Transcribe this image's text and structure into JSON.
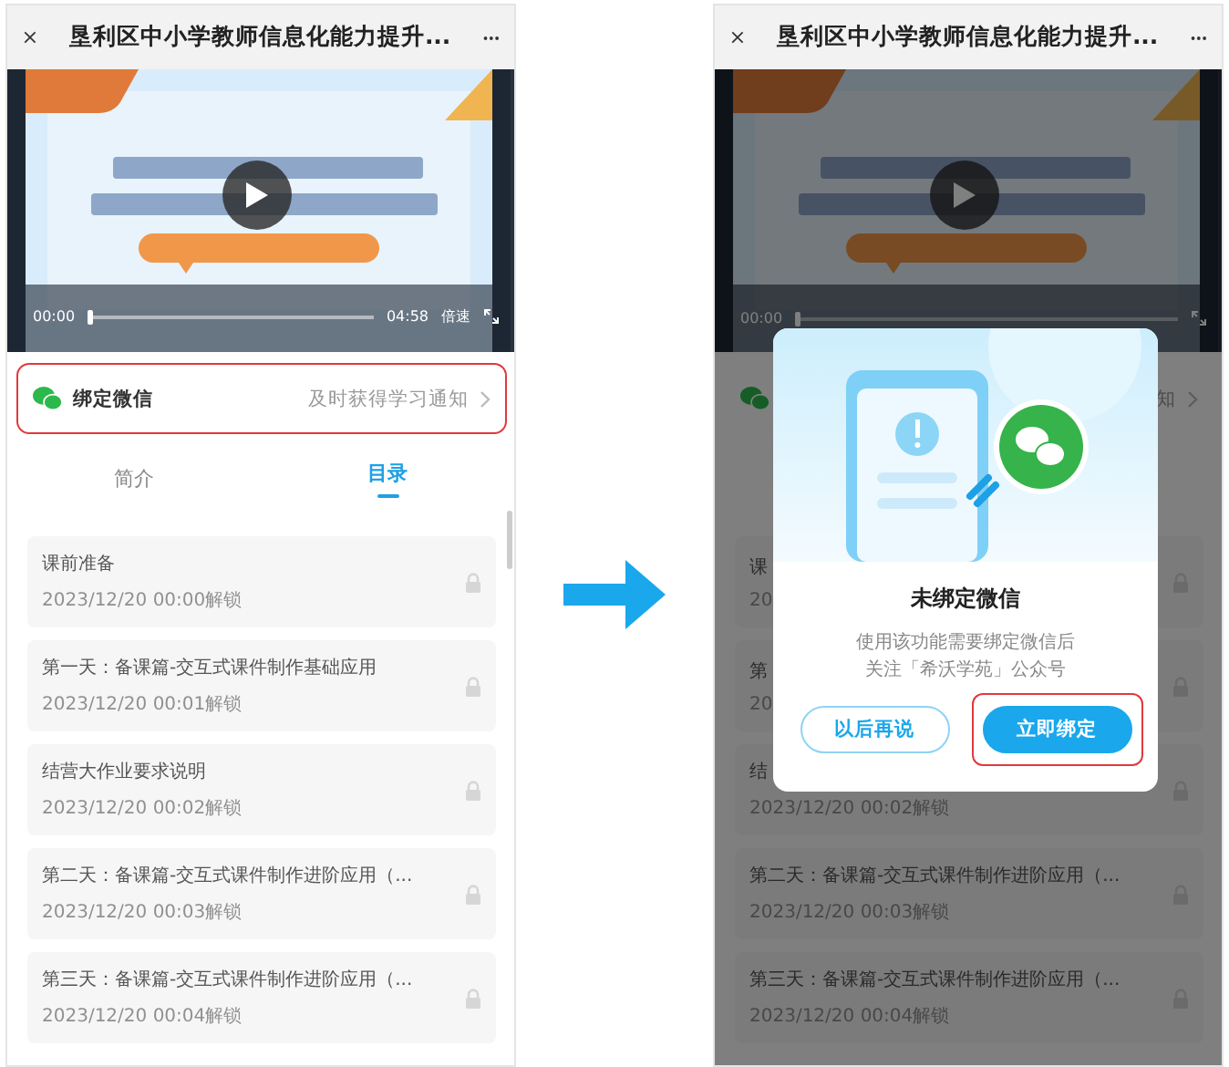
{
  "screens": [
    {
      "nav": {
        "title": "垦利区中小学教师信息化能力提升..."
      },
      "player": {
        "elapsed": "00:00",
        "duration": "04:58",
        "speed": "倍速",
        "level": 0
      },
      "bind_row": {
        "label": "绑定微信",
        "hint": "及时获得学习通知",
        "highlighted": true
      },
      "tabs": [
        {
          "label": "简介",
          "selected": false
        },
        {
          "label": "目录",
          "selected": true
        }
      ],
      "lessons": [
        {
          "title": "课前准备",
          "unlock": "2023/12/20 00:00解锁",
          "locked": true
        },
        {
          "title": "第一天：备课篇-交互式课件制作基础应用",
          "unlock": "2023/12/20 00:01解锁",
          "locked": true
        },
        {
          "title": "结营大作业要求说明",
          "unlock": "2023/12/20 00:02解锁",
          "locked": true
        },
        {
          "title": "第二天：备课篇-交互式课件制作进阶应用（...",
          "unlock": "2023/12/20 00:03解锁",
          "locked": true
        },
        {
          "title": "第三天：备课篇-交互式课件制作进阶应用（...",
          "unlock": "2023/12/20 00:04解锁",
          "locked": true
        }
      ],
      "dimmed": false
    },
    {
      "nav": {
        "title": "垦利区中小学教师信息化能力提升..."
      },
      "player": {
        "elapsed": "00:00",
        "level": 0
      },
      "bind_row": {
        "hint": "知",
        "highlighted": false
      },
      "lessons": [
        {
          "title": "课",
          "unlock": "20",
          "locked": true
        },
        {
          "title": "第",
          "unlock": "20",
          "locked": true
        },
        {
          "title": "结",
          "unlock": "2023/12/20 00:02解锁",
          "locked": true
        },
        {
          "title": "第二天：备课篇-交互式课件制作进阶应用（...",
          "unlock": "2023/12/20 00:03解锁",
          "locked": true
        },
        {
          "title": "第三天：备课篇-交互式课件制作进阶应用（...",
          "unlock": "2023/12/20 00:04解锁",
          "locked": true
        }
      ],
      "dimmed": true,
      "dialog": {
        "title": "未绑定微信",
        "message": [
          "使用该功能需要绑定微信后",
          "关注「希沃学苑」公众号"
        ],
        "buttons": [
          {
            "label": "以后再说",
            "kind": "secondary",
            "highlighted": false
          },
          {
            "label": "立即绑定",
            "kind": "primary",
            "highlighted": true
          }
        ]
      }
    }
  ]
}
